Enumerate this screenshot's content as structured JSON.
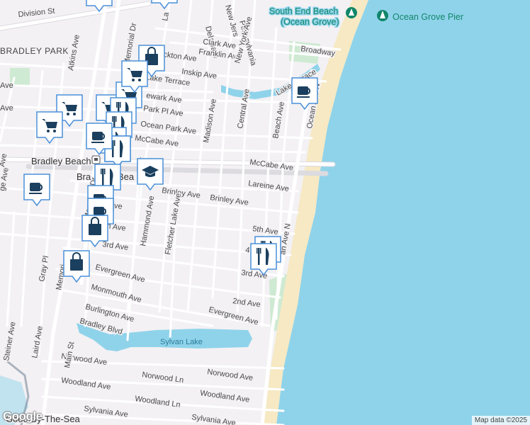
{
  "map": {
    "area_labels": [
      "BRADLEY PARK"
    ],
    "town_labels": [
      "Bradley Beach",
      "Bra",
      "Bea",
      "Ocean Grove",
      "Good By-The-Sea"
    ],
    "water_labels": [
      "Sylvan Lake"
    ],
    "poi_labels": [
      "South End Beach",
      "(Ocean Grove)",
      "Ocean Grove Pier"
    ],
    "street_labels": {
      "division_st": "Division St",
      "atkins": "Atkins Ave",
      "memorial_dr": "Memorial Dr",
      "memorial_dr_2": "Memorial Dr",
      "memorial_dr_3": "Memori",
      "delaware": "Delaware",
      "new_jersey": "New Jers",
      "pennsylvania": "Pennsylvania",
      "clark": "Clark Ave",
      "franklin": "Franklin Ave",
      "new_york": "New York Ave",
      "broadway": "Broadway",
      "stockton": "ckton Ave",
      "inskip": "Inskip Ave",
      "lake_terrace": "Lake Terrace",
      "lake_terrace_2": "Lake Terrace",
      "newark": "ewark Ave",
      "park_pl": "Park Pl Ave",
      "ocean_park": "Ocean Park Ave",
      "mccabe_w": "McCabe Ave",
      "mccabe_e": "McCabe Ave",
      "madison": "Madison Ave",
      "central": "Central Ave",
      "beach": "Beach Ave",
      "ocean_ave": "Ocean Ave N",
      "ocean_ave_2": "an Ave N",
      "lareine": "Lareine Ave",
      "brinley": "Brinley Ave",
      "brinley_w": "Brinley Ave",
      "fifth": "5th Ave",
      "fifth_w": "5th Ave",
      "fourth": "4",
      "third": "3rd Ave",
      "third_w": "3rd Ave",
      "second": "2nd Ave",
      "evergreen_e": "Evergreen Ave",
      "evergreen_w": "Evergreen Ave",
      "monmouth": "Monmouth Ave",
      "burlington": "Burlington Ave",
      "bradley_blvd": "Bradley Blvd",
      "norwood_w": "Norwood Ave",
      "norwood_ln": "Norwood Ln",
      "norwood_e": "Norwood Ave",
      "woodland_w": "Woodland Ave",
      "woodland_ln": "Woodland Ln",
      "woodland_e": "Woodland Ave",
      "sylvania_w": "Sylvania Ave",
      "sylvania_e": "Sylvania Ave",
      "hammond": "Hammond Ave",
      "fletcher": "Fletcher Lake Ave",
      "gray_pl": "Gray Pl",
      "main_st": "Main St",
      "laird": "Laird Ave",
      "steiner": "Steiner Ave",
      "ge": "ge Ave",
      "ave_left1": "Ave",
      "ave_left2": "Ave",
      "h_ave": "h Ave",
      "third_short": "3rd Ave",
      "la": "La",
      "ti": "ti",
      "ine": "ine",
      "h_ave2": "h Ave",
      "ave_w3": "Ave",
      "p_ave": "p Ave"
    },
    "markers": [
      {
        "id": "m1",
        "icon": "shopping-bag-icon"
      },
      {
        "id": "m2",
        "icon": "shopping-bag-icon"
      },
      {
        "id": "m3",
        "icon": "shopping-cart-icon"
      },
      {
        "id": "m4",
        "icon": "shopping-cart-icon"
      },
      {
        "id": "m5",
        "icon": "shopping-cart-icon"
      },
      {
        "id": "m6",
        "icon": "shopping-cart-icon"
      },
      {
        "id": "m7",
        "icon": "shopping-bag-icon"
      },
      {
        "id": "m8",
        "icon": "shopping-cart-icon"
      },
      {
        "id": "m9",
        "icon": "restaurant-icon"
      },
      {
        "id": "m10",
        "icon": "restaurant-icon"
      },
      {
        "id": "m11",
        "icon": "restaurant-icon"
      },
      {
        "id": "m12",
        "icon": "restaurant-icon"
      },
      {
        "id": "m13",
        "icon": "restaurant-icon"
      },
      {
        "id": "m14",
        "icon": "cafe-icon"
      },
      {
        "id": "m15",
        "icon": "school-icon"
      },
      {
        "id": "m16",
        "icon": "restaurant-icon"
      },
      {
        "id": "m17",
        "icon": "cafe-icon"
      },
      {
        "id": "m18",
        "icon": "cafe-icon"
      },
      {
        "id": "m19",
        "icon": "cafe-icon"
      },
      {
        "id": "m20",
        "icon": "shopping-bag-icon"
      },
      {
        "id": "m21",
        "icon": "shopping-bag-icon"
      },
      {
        "id": "m22",
        "icon": "cafe-icon"
      },
      {
        "id": "m23",
        "icon": "restaurant-icon"
      },
      {
        "id": "m24",
        "icon": "restaurant-icon"
      }
    ],
    "transit_icon": "train-station-icon",
    "poi_icons": [
      "beach-pin-icon",
      "tree-pin-icon"
    ],
    "colors": {
      "land": "#f3f1f4",
      "water": "#8fd3ea",
      "sand": "#f6e9c3",
      "park": "#cfead3",
      "road": "#ffffff",
      "road_casing": "#dcdbe0",
      "marker_fill": "#ffffff",
      "marker_border": "#4a90d9",
      "marker_icon": "#1b3f5e"
    }
  },
  "branding": {
    "logo": "Google"
  },
  "attribution": "Map data ©2025"
}
